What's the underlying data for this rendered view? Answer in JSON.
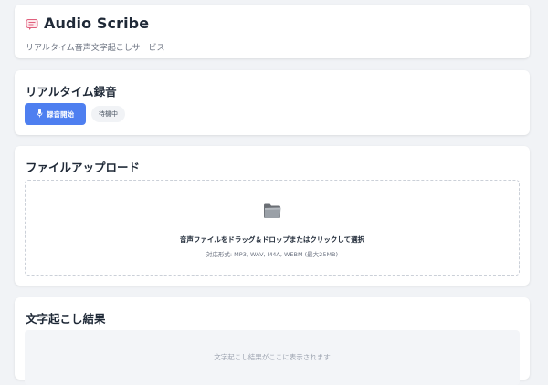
{
  "header": {
    "app_icon": "speech-bubble-icon",
    "title": "Audio Scribe",
    "subtitle": "リアルタイム音声文字起こしサービス"
  },
  "realtime": {
    "title": "リアルタイム録音",
    "record_button_label": "録音開始",
    "record_button_icon": "microphone-icon",
    "status": "待機中",
    "accent_color": "#4e7ff0"
  },
  "upload": {
    "title": "ファイルアップロード",
    "dropzone_icon": "folder-icon",
    "dropzone_text": "音声ファイルをドラッグ＆ドロップまたはクリックして選択",
    "supported_formats": "対応形式: MP3, WAV, M4A, WEBM (最大25MB)"
  },
  "result": {
    "title": "文字起こし結果",
    "placeholder": "文字起こし結果がここに表示されます"
  }
}
